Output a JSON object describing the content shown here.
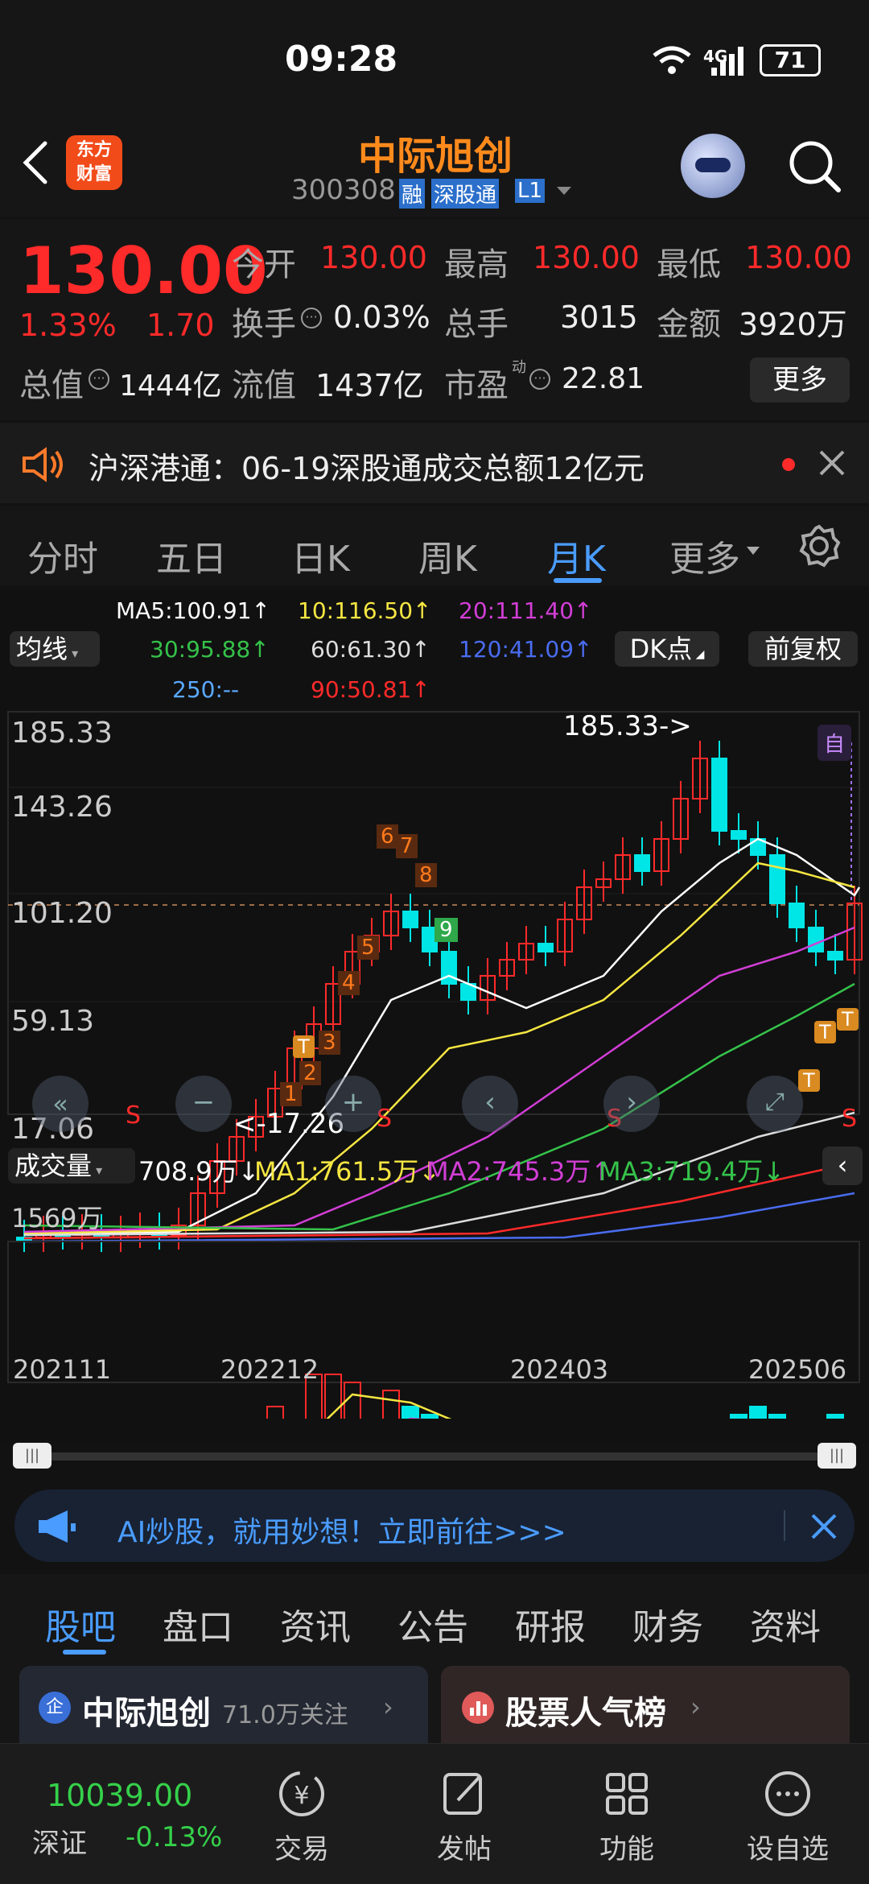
{
  "status": {
    "time": "09:28",
    "battery": "71",
    "network": "4G"
  },
  "header": {
    "stock_name": "中际旭创",
    "code": "300308",
    "badge_rong": "融",
    "badge_connect": "深股通",
    "badge_level": "L1",
    "logo_line1": "东方",
    "logo_line2": "财富"
  },
  "quote": {
    "price": "130.00",
    "change_pct": "1.33%",
    "change_amt": "1.70",
    "open_label": "今开",
    "open": "130.00",
    "high_label": "最高",
    "high": "130.00",
    "low_label": "最低",
    "low": "130.00",
    "turnover_label": "换手",
    "turnover": "0.03%",
    "volume_label": "总手",
    "volume": "3015",
    "amount_label": "金额",
    "amount": "3920万",
    "mcap_label": "总值",
    "mcap": "1444亿",
    "float_label": "流值",
    "float": "1437亿",
    "pe_label": "市盈",
    "pe_super": "动",
    "pe": "22.81",
    "more": "更多"
  },
  "notice": {
    "text": "沪深港通：06-19深股通成交总额12亿元"
  },
  "period_tabs": [
    "分时",
    "五日",
    "日K",
    "周K",
    "月K",
    "更多"
  ],
  "active_tab": "月K",
  "ma": {
    "toggle": "均线",
    "ma5": "MA5:100.91↑",
    "ma10": "10:116.50↑",
    "ma20": "20:111.40↑",
    "ma30": "30:95.88↑",
    "ma60": "60:61.30↑",
    "ma120": "120:41.09↑",
    "ma250": "250:--",
    "ma90": "90:50.81↑",
    "dk": "DK点",
    "fq": "前复权"
  },
  "price_axis": [
    "185.33",
    "143.26",
    "101.20",
    "59.13",
    "17.06"
  ],
  "annotations": {
    "high": "185.33->",
    "low": "<-17.26",
    "auto": "自",
    "seq": [
      "1",
      "2",
      "3",
      "4",
      "5",
      "6",
      "7",
      "8",
      "9"
    ],
    "signal_T": "T",
    "signal_S": "S"
  },
  "volume": {
    "label": "成交量",
    "value": "708.9万↓",
    "ma1": "MA1:761.5万↓",
    "ma2": "MA2:745.3万↑",
    "ma3": "MA3:719.4万↓",
    "axis_max": "1569万"
  },
  "date_axis": [
    "202111",
    "202212",
    "202403",
    "202506"
  ],
  "ad": {
    "text": "AI炒股，就用妙想！立即前往>>>"
  },
  "bottom_tabs": [
    "股吧",
    "盘口",
    "资讯",
    "公告",
    "研报",
    "财务",
    "资料"
  ],
  "cards": {
    "card1_title": "中际旭创",
    "card1_sub": "71.0万关注",
    "card2_title": "股票人气榜"
  },
  "navbar": {
    "index_value": "10039.00",
    "index_name": "深证",
    "index_change": "-0.13%",
    "items": [
      "交易",
      "发帖",
      "功能",
      "设自选"
    ]
  },
  "colors": {
    "up": "#ff2a2a",
    "down": "#00e5e5",
    "accent": "#4a9cff",
    "bg": "#121212"
  }
}
